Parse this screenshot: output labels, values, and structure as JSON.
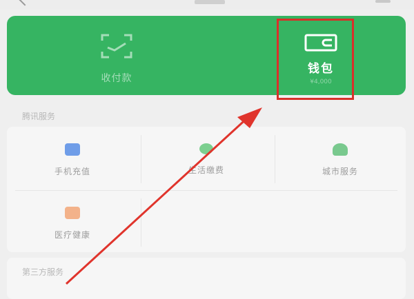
{
  "header": {
    "back_icon": "chevron-left-icon",
    "more_icon": "more-icon"
  },
  "banner": {
    "color": "#36b462",
    "scan": {
      "label": "收付款",
      "icon": "scan-icon"
    },
    "wallet": {
      "label": "钱包",
      "sub": "¥4,000",
      "icon": "wallet-icon"
    }
  },
  "services": {
    "title": "腾讯服务",
    "items": [
      {
        "label": "手机充值",
        "icon": "phone-recharge-icon",
        "color": "#6f9de8"
      },
      {
        "label": "生活缴费",
        "icon": "life-payment-icon",
        "color": "#7ccf8f"
      },
      {
        "label": "城市服务",
        "icon": "city-service-icon",
        "color": "#79c98e"
      },
      {
        "label": "医疗健康",
        "icon": "health-icon",
        "color": "#f3b28a"
      }
    ]
  },
  "third_party": {
    "title": "第三方服务"
  },
  "annotation": {
    "highlight_color": "#d9302a"
  }
}
